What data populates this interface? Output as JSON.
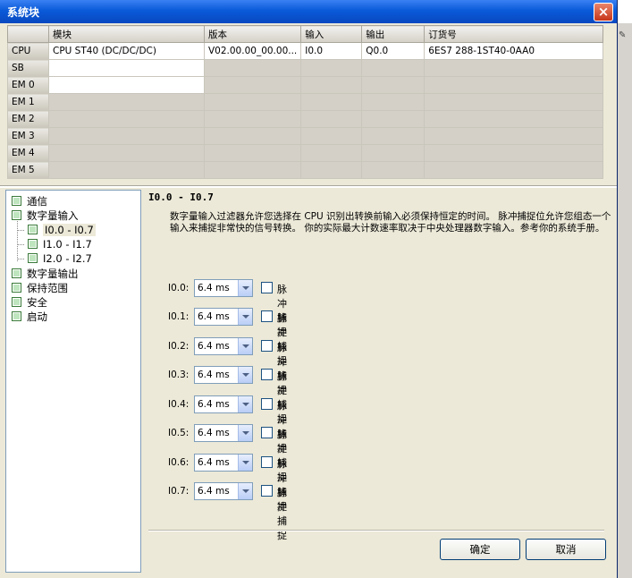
{
  "window": {
    "title": "系统块",
    "close_label": "×"
  },
  "table": {
    "headers": [
      "",
      "模块",
      "版本",
      "输入",
      "输出",
      "订货号"
    ],
    "rows": [
      {
        "slot": "CPU",
        "module": "CPU ST40 (DC/DC/DC)",
        "version": "V02.00.00_00.00...",
        "input": "I0.0",
        "output": "Q0.0",
        "order": "6ES7 288-1ST40-0AA0"
      },
      {
        "slot": "SB",
        "module": "",
        "version": "",
        "input": "",
        "output": "",
        "order": ""
      },
      {
        "slot": "EM 0",
        "module": "",
        "version": "",
        "input": "",
        "output": "",
        "order": ""
      },
      {
        "slot": "EM 1",
        "module": "",
        "version": "",
        "input": "",
        "output": "",
        "order": ""
      },
      {
        "slot": "EM 2",
        "module": "",
        "version": "",
        "input": "",
        "output": "",
        "order": ""
      },
      {
        "slot": "EM 3",
        "module": "",
        "version": "",
        "input": "",
        "output": "",
        "order": ""
      },
      {
        "slot": "EM 4",
        "module": "",
        "version": "",
        "input": "",
        "output": "",
        "order": ""
      },
      {
        "slot": "EM 5",
        "module": "",
        "version": "",
        "input": "",
        "output": "",
        "order": ""
      }
    ]
  },
  "tree": {
    "items": [
      {
        "label": "通信"
      },
      {
        "label": "数字量输入"
      },
      {
        "label": "I0.0 - I0.7"
      },
      {
        "label": "I1.0 - I1.7"
      },
      {
        "label": "I2.0 - I2.7"
      },
      {
        "label": "数字量输出"
      },
      {
        "label": "保持范围"
      },
      {
        "label": "安全"
      },
      {
        "label": "启动"
      }
    ]
  },
  "panel": {
    "heading": "I0.0 - I0.7",
    "description": "数字量输入过滤器允许您选择在 CPU 识别出转换前输入必须保持恒定的时间。 脉冲捕捉位允许您组态一个输入来捕捉非常快的信号转换。 你的实际最大计数速率取决于中央处理器数字输入。参考你的系统手册。",
    "inputs": [
      {
        "label": "I0.0:",
        "value": "6.4 ms",
        "checkbox": "脉冲捕捉"
      },
      {
        "label": "I0.1:",
        "value": "6.4 ms",
        "checkbox": "脉冲捕捉"
      },
      {
        "label": "I0.2:",
        "value": "6.4 ms",
        "checkbox": "脉冲捕捉"
      },
      {
        "label": "I0.3:",
        "value": "6.4 ms",
        "checkbox": "脉冲捕捉"
      },
      {
        "label": "I0.4:",
        "value": "6.4 ms",
        "checkbox": "脉冲捕捉"
      },
      {
        "label": "I0.5:",
        "value": "6.4 ms",
        "checkbox": "脉冲捕捉"
      },
      {
        "label": "I0.6:",
        "value": "6.4 ms",
        "checkbox": "脉冲捕捉"
      },
      {
        "label": "I0.7:",
        "value": "6.4 ms",
        "checkbox": "脉冲捕捉"
      }
    ],
    "ok_label": "确定",
    "cancel_label": "取消"
  }
}
